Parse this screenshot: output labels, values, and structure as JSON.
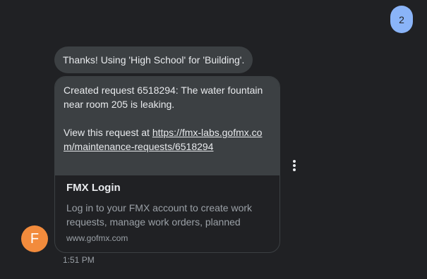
{
  "sent_message": {
    "text": "2",
    "color": "#8ab4f8"
  },
  "messages": [
    {
      "text": "Thanks! Using 'High School' for 'Building'."
    }
  ],
  "request_card": {
    "line1": "Created request 6518294: The water fountain near room 205 is leaking.",
    "view_prefix": "View this request at ",
    "link": "https://fmx-labs.gofmx.com/maintenance-requests/6518294",
    "preview": {
      "title": "FMX Login",
      "description": "Log in to your FMX account to create work requests, manage work orders, planned",
      "domain": "www.gofmx.com"
    }
  },
  "more_options_icon": "more-vert-icon",
  "avatar": {
    "initial": "F",
    "color": "#f28b3c"
  },
  "timestamp": "1:51 PM"
}
